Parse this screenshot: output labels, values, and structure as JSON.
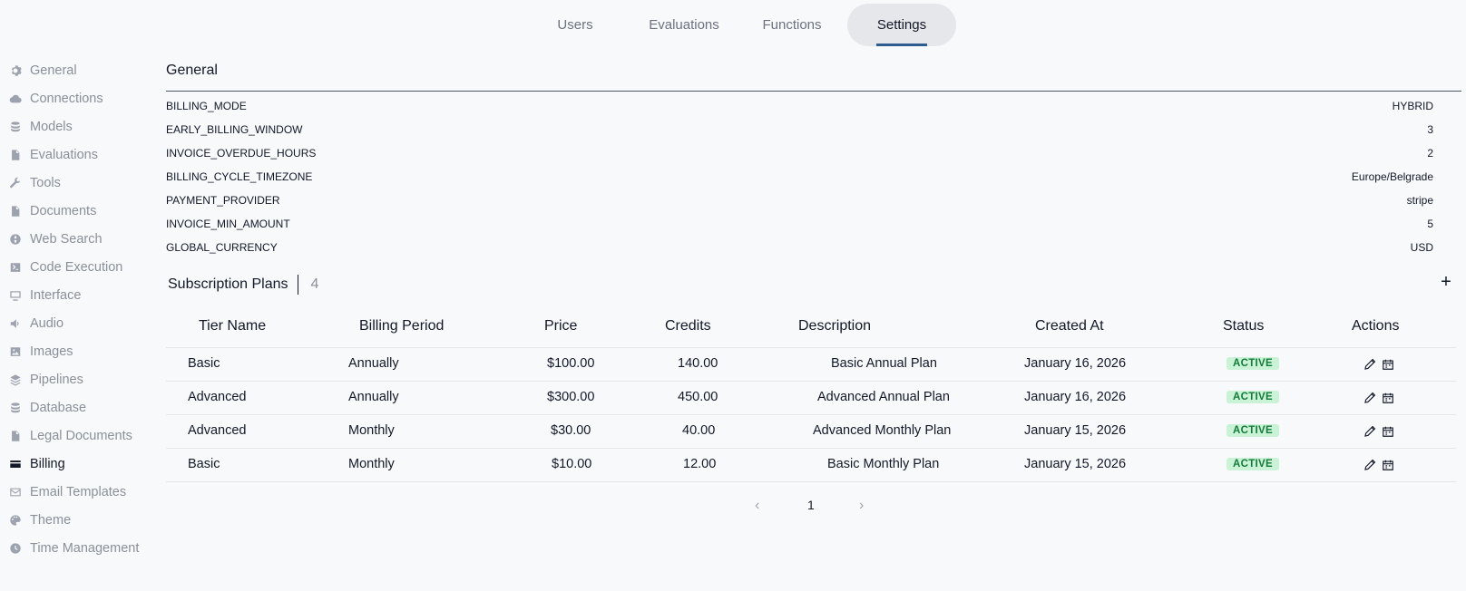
{
  "topnav": {
    "tabs": [
      {
        "label": "Users"
      },
      {
        "label": "Evaluations"
      },
      {
        "label": "Functions"
      },
      {
        "label": "Settings",
        "active": true
      }
    ]
  },
  "sidebar": {
    "items": [
      {
        "label": "General",
        "icon": "gear-icon"
      },
      {
        "label": "Connections",
        "icon": "cloud-icon"
      },
      {
        "label": "Models",
        "icon": "stack-icon"
      },
      {
        "label": "Evaluations",
        "icon": "document-icon"
      },
      {
        "label": "Tools",
        "icon": "wrench-icon"
      },
      {
        "label": "Documents",
        "icon": "document-icon"
      },
      {
        "label": "Web Search",
        "icon": "globe-icon"
      },
      {
        "label": "Code Execution",
        "icon": "terminal-icon"
      },
      {
        "label": "Interface",
        "icon": "monitor-icon"
      },
      {
        "label": "Audio",
        "icon": "speaker-icon"
      },
      {
        "label": "Images",
        "icon": "image-icon"
      },
      {
        "label": "Pipelines",
        "icon": "layers-icon"
      },
      {
        "label": "Database",
        "icon": "database-icon"
      },
      {
        "label": "Legal Documents",
        "icon": "document-icon"
      },
      {
        "label": "Billing",
        "icon": "credit-card-icon",
        "active": true
      },
      {
        "label": "Email Templates",
        "icon": "mail-icon"
      },
      {
        "label": "Theme",
        "icon": "palette-icon"
      },
      {
        "label": "Time Management",
        "icon": "clock-icon"
      }
    ]
  },
  "general": {
    "title": "General",
    "settings": [
      {
        "key": "BILLING_MODE",
        "value": "HYBRID"
      },
      {
        "key": "EARLY_BILLING_WINDOW",
        "value": "3"
      },
      {
        "key": "INVOICE_OVERDUE_HOURS",
        "value": "2"
      },
      {
        "key": "BILLING_CYCLE_TIMEZONE",
        "value": "Europe/Belgrade"
      },
      {
        "key": "PAYMENT_PROVIDER",
        "value": "stripe"
      },
      {
        "key": "INVOICE_MIN_AMOUNT",
        "value": "5"
      },
      {
        "key": "GLOBAL_CURRENCY",
        "value": "USD"
      }
    ]
  },
  "plans": {
    "title": "Subscription Plans",
    "count": "4",
    "add_label": "+",
    "columns": [
      "Tier Name",
      "Billing Period",
      "Price",
      "Credits",
      "Description",
      "Created At",
      "Status",
      "Actions"
    ],
    "rows": [
      {
        "tier": "Basic",
        "period": "Annually",
        "price": "$100.00",
        "credits": "140.00",
        "description": "Basic Annual Plan",
        "created": "January 16, 2026",
        "status": "ACTIVE"
      },
      {
        "tier": "Advanced",
        "period": "Annually",
        "price": "$300.00",
        "credits": "450.00",
        "description": "Advanced Annual Plan",
        "created": "January 16, 2026",
        "status": "ACTIVE"
      },
      {
        "tier": "Advanced",
        "period": "Monthly",
        "price": "$30.00",
        "credits": "40.00",
        "description": "Advanced Monthly Plan",
        "created": "January 15, 2026",
        "status": "ACTIVE"
      },
      {
        "tier": "Basic",
        "period": "Monthly",
        "price": "$10.00",
        "credits": "12.00",
        "description": "Basic Monthly Plan",
        "created": "January 15, 2026",
        "status": "ACTIVE"
      }
    ]
  },
  "pagination": {
    "prev": "‹",
    "page": "1",
    "next": "›"
  },
  "colors": {
    "accent": "#2f5c8f",
    "badge_bg": "#c9f2d6",
    "badge_text": "#157a3a"
  }
}
